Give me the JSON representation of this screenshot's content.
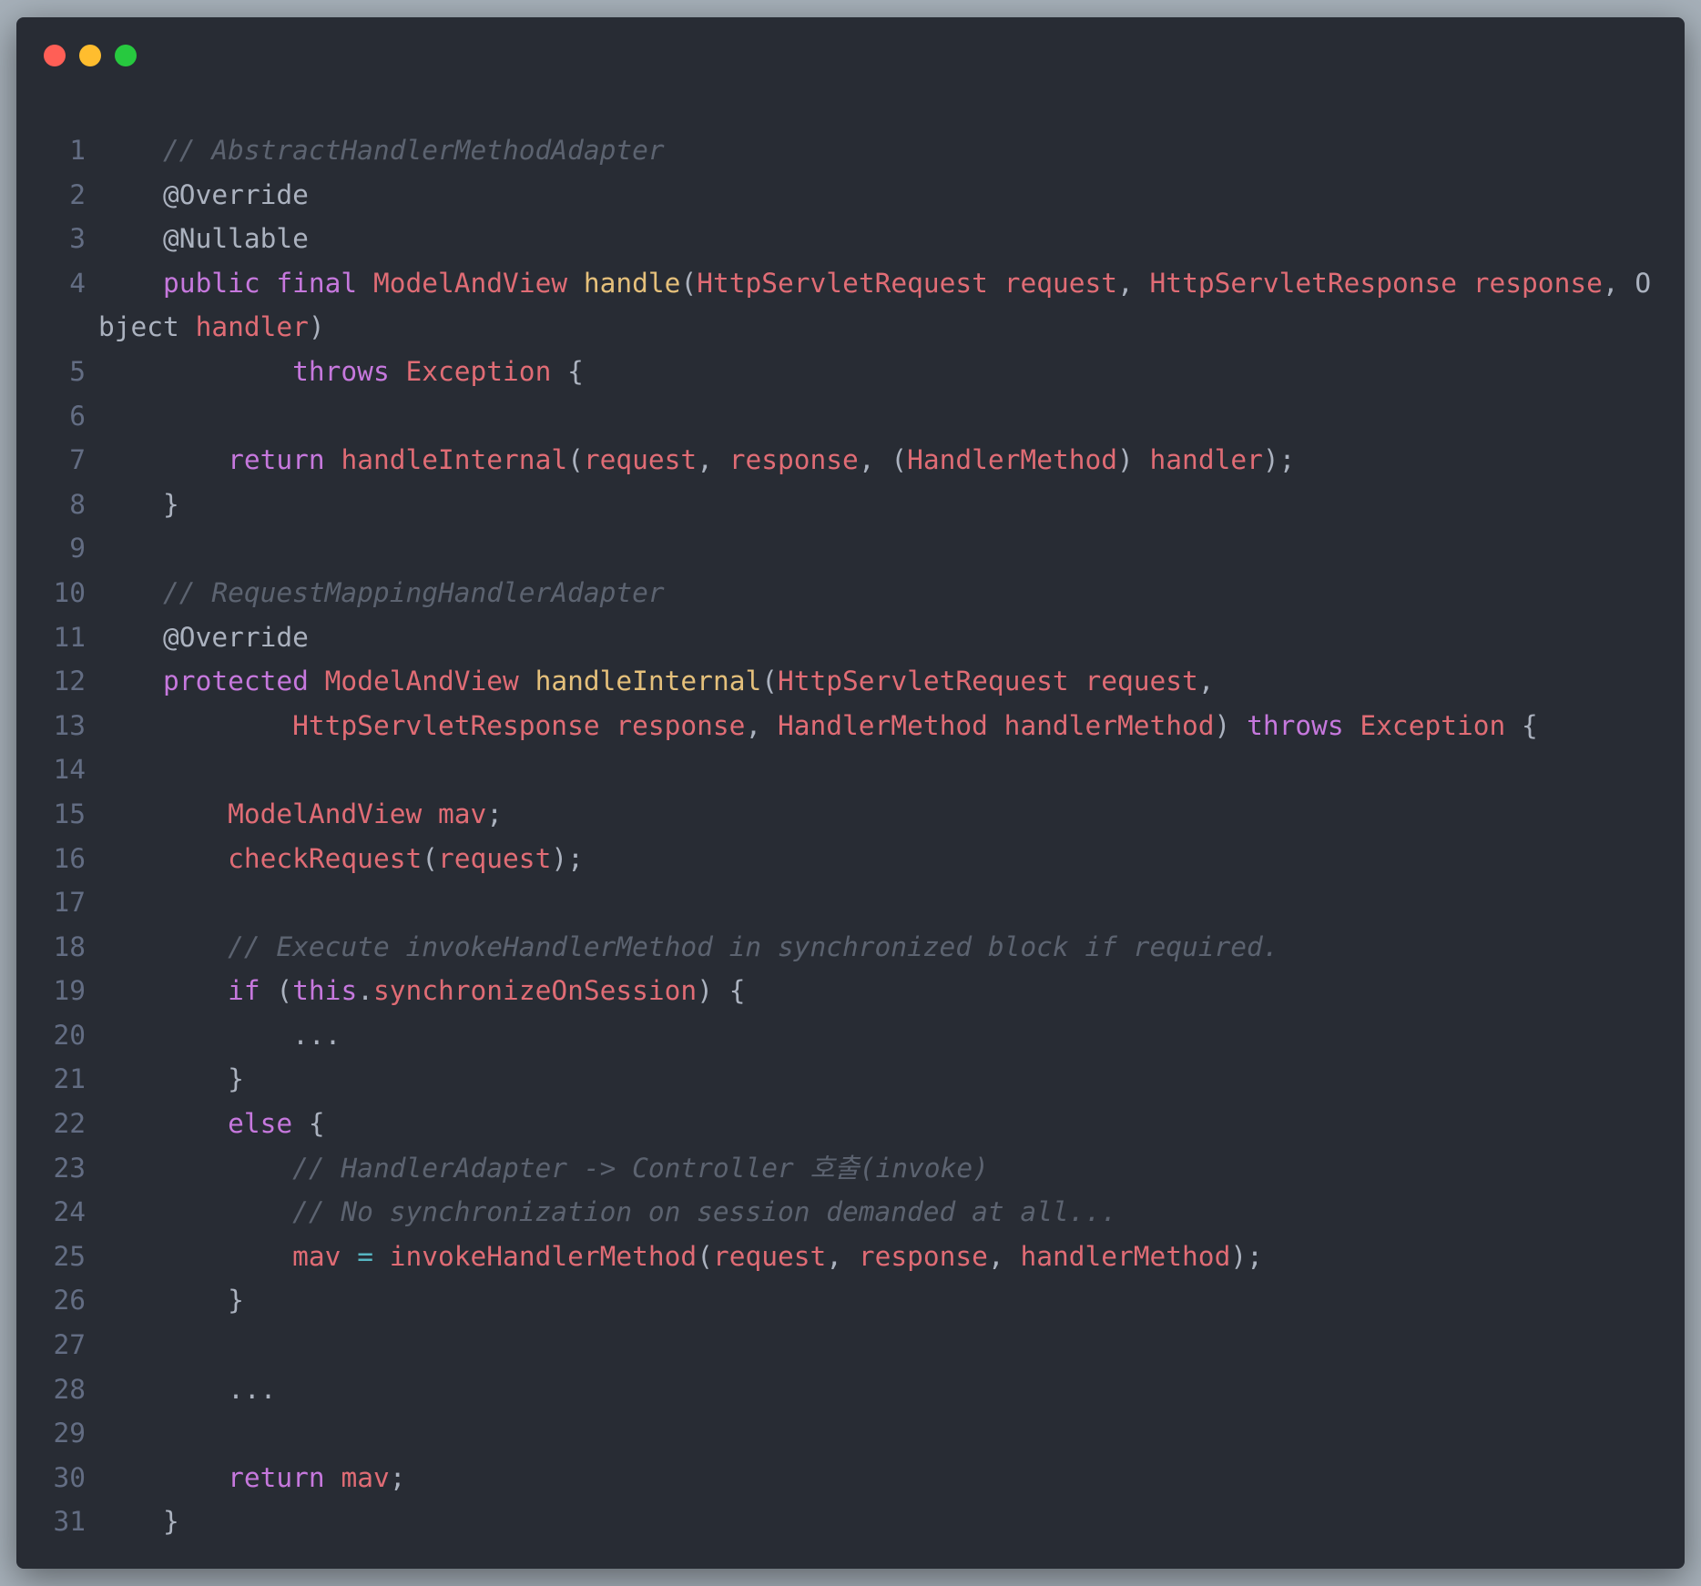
{
  "window": {
    "traffic_lights": [
      "close",
      "minimize",
      "maximize"
    ],
    "colors": {
      "background": "#282c34",
      "close": "#ff5f56",
      "minimize": "#ffbd2e",
      "maximize": "#27c93f"
    }
  },
  "code": {
    "lines": [
      {
        "num": "1",
        "tokens": [
          {
            "t": "    "
          },
          {
            "t": "// AbstractHandlerMethodAdapter",
            "c": "comment"
          }
        ]
      },
      {
        "num": "2",
        "tokens": [
          {
            "t": "    @Override"
          }
        ]
      },
      {
        "num": "3",
        "tokens": [
          {
            "t": "    @Nullable"
          }
        ]
      },
      {
        "num": "4",
        "wrap": true,
        "tokens": [
          {
            "t": "    "
          },
          {
            "t": "public",
            "c": "kw"
          },
          {
            "t": " "
          },
          {
            "t": "final",
            "c": "kw"
          },
          {
            "t": " "
          },
          {
            "t": "ModelAndView",
            "c": "type"
          },
          {
            "t": " "
          },
          {
            "t": "handle",
            "c": "fn"
          },
          {
            "t": "("
          },
          {
            "t": "HttpServletRequest",
            "c": "type"
          },
          {
            "t": " "
          },
          {
            "t": "request",
            "c": "var"
          },
          {
            "t": ", "
          },
          {
            "t": "HttpServletResponse",
            "c": "type"
          },
          {
            "t": " "
          },
          {
            "t": "response",
            "c": "var"
          },
          {
            "t": ", Object "
          },
          {
            "t": "handler",
            "c": "var"
          },
          {
            "t": ")"
          }
        ]
      },
      {
        "num": "5",
        "tokens": [
          {
            "t": "            "
          },
          {
            "t": "throws",
            "c": "kw"
          },
          {
            "t": " "
          },
          {
            "t": "Exception",
            "c": "type"
          },
          {
            "t": " {"
          }
        ]
      },
      {
        "num": "6",
        "tokens": []
      },
      {
        "num": "7",
        "tokens": [
          {
            "t": "        "
          },
          {
            "t": "return",
            "c": "kw"
          },
          {
            "t": " "
          },
          {
            "t": "handleInternal",
            "c": "var"
          },
          {
            "t": "("
          },
          {
            "t": "request",
            "c": "var"
          },
          {
            "t": ", "
          },
          {
            "t": "response",
            "c": "var"
          },
          {
            "t": ", ("
          },
          {
            "t": "HandlerMethod",
            "c": "type"
          },
          {
            "t": ") "
          },
          {
            "t": "handler",
            "c": "var"
          },
          {
            "t": ");"
          }
        ]
      },
      {
        "num": "8",
        "tokens": [
          {
            "t": "    }"
          }
        ]
      },
      {
        "num": "9",
        "tokens": []
      },
      {
        "num": "10",
        "tokens": [
          {
            "t": "    "
          },
          {
            "t": "// RequestMappingHandlerAdapter",
            "c": "comment"
          }
        ]
      },
      {
        "num": "11",
        "tokens": [
          {
            "t": "    @Override"
          }
        ]
      },
      {
        "num": "12",
        "tokens": [
          {
            "t": "    "
          },
          {
            "t": "protected",
            "c": "kw"
          },
          {
            "t": " "
          },
          {
            "t": "ModelAndView",
            "c": "type"
          },
          {
            "t": " "
          },
          {
            "t": "handleInternal",
            "c": "fn"
          },
          {
            "t": "("
          },
          {
            "t": "HttpServletRequest",
            "c": "type"
          },
          {
            "t": " "
          },
          {
            "t": "request",
            "c": "var"
          },
          {
            "t": ","
          }
        ]
      },
      {
        "num": "13",
        "tokens": [
          {
            "t": "            "
          },
          {
            "t": "HttpServletResponse",
            "c": "type"
          },
          {
            "t": " "
          },
          {
            "t": "response",
            "c": "var"
          },
          {
            "t": ", "
          },
          {
            "t": "HandlerMethod",
            "c": "type"
          },
          {
            "t": " "
          },
          {
            "t": "handlerMethod",
            "c": "var"
          },
          {
            "t": ") "
          },
          {
            "t": "throws",
            "c": "kw"
          },
          {
            "t": " "
          },
          {
            "t": "Exception",
            "c": "type"
          },
          {
            "t": " {"
          }
        ]
      },
      {
        "num": "14",
        "tokens": []
      },
      {
        "num": "15",
        "tokens": [
          {
            "t": "        "
          },
          {
            "t": "ModelAndView",
            "c": "type"
          },
          {
            "t": " "
          },
          {
            "t": "mav",
            "c": "var"
          },
          {
            "t": ";"
          }
        ]
      },
      {
        "num": "16",
        "tokens": [
          {
            "t": "        "
          },
          {
            "t": "checkRequest",
            "c": "var"
          },
          {
            "t": "("
          },
          {
            "t": "request",
            "c": "var"
          },
          {
            "t": ");"
          }
        ]
      },
      {
        "num": "17",
        "tokens": []
      },
      {
        "num": "18",
        "tokens": [
          {
            "t": "        "
          },
          {
            "t": "// Execute invokeHandlerMethod in synchronized block if required.",
            "c": "comment"
          }
        ]
      },
      {
        "num": "19",
        "tokens": [
          {
            "t": "        "
          },
          {
            "t": "if",
            "c": "kw"
          },
          {
            "t": " ("
          },
          {
            "t": "this",
            "c": "kw"
          },
          {
            "t": "."
          },
          {
            "t": "synchronizeOnSession",
            "c": "var"
          },
          {
            "t": ") {"
          }
        ]
      },
      {
        "num": "20",
        "tokens": [
          {
            "t": "            ..."
          }
        ]
      },
      {
        "num": "21",
        "tokens": [
          {
            "t": "        }"
          }
        ]
      },
      {
        "num": "22",
        "tokens": [
          {
            "t": "        "
          },
          {
            "t": "else",
            "c": "kw"
          },
          {
            "t": " {"
          }
        ]
      },
      {
        "num": "23",
        "tokens": [
          {
            "t": "            "
          },
          {
            "t": "// HandlerAdapter -> Controller 호출(invoke)",
            "c": "comment"
          }
        ]
      },
      {
        "num": "24",
        "tokens": [
          {
            "t": "            "
          },
          {
            "t": "// No synchronization on session demanded at all...",
            "c": "comment"
          }
        ]
      },
      {
        "num": "25",
        "tokens": [
          {
            "t": "            "
          },
          {
            "t": "mav",
            "c": "var"
          },
          {
            "t": " "
          },
          {
            "t": "=",
            "c": "op"
          },
          {
            "t": " "
          },
          {
            "t": "invokeHandlerMethod",
            "c": "var"
          },
          {
            "t": "("
          },
          {
            "t": "request",
            "c": "var"
          },
          {
            "t": ", "
          },
          {
            "t": "response",
            "c": "var"
          },
          {
            "t": ", "
          },
          {
            "t": "handlerMethod",
            "c": "var"
          },
          {
            "t": ");"
          }
        ]
      },
      {
        "num": "26",
        "tokens": [
          {
            "t": "        }"
          }
        ]
      },
      {
        "num": "27",
        "tokens": []
      },
      {
        "num": "28",
        "tokens": [
          {
            "t": "        ..."
          }
        ]
      },
      {
        "num": "29",
        "tokens": []
      },
      {
        "num": "30",
        "tokens": [
          {
            "t": "        "
          },
          {
            "t": "return",
            "c": "kw"
          },
          {
            "t": " "
          },
          {
            "t": "mav",
            "c": "var"
          },
          {
            "t": ";"
          }
        ]
      },
      {
        "num": "31",
        "tokens": [
          {
            "t": "    }"
          }
        ]
      }
    ]
  }
}
